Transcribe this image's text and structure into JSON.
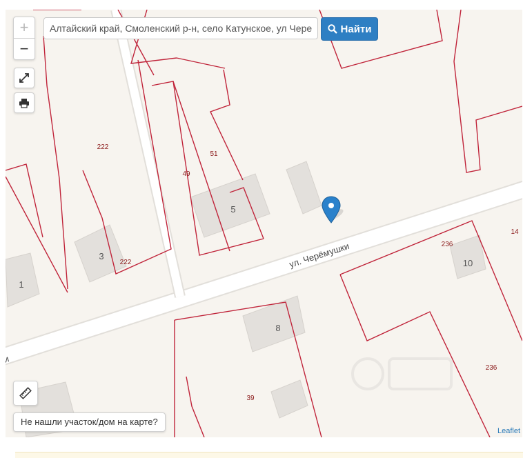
{
  "search": {
    "value": "Алтайский край, Смоленский р-н, село Катунское, ул Черемушки",
    "button_label": "Найти"
  },
  "zoom": {
    "in_label": "+",
    "out_label": "−"
  },
  "map": {
    "street_label": "ул. Черёмушки",
    "street_fragment": "и",
    "building_numbers": [
      "1",
      "3",
      "5",
      "8",
      "10"
    ],
    "parcel_numbers": [
      "222",
      "222",
      "51",
      "49",
      "236",
      "14",
      "236",
      "39"
    ]
  },
  "not_found_label": "Не нашли участок/дом на карте?",
  "attribution": "Leaflet",
  "colors": {
    "parcel_line": "#c0243a",
    "parcel_label": "#8b1a1a",
    "building": "#e3e0dc",
    "road": "#ffffff",
    "marker": "#2a81cb",
    "button": "#2e7fc3"
  },
  "icons": {
    "zoom_in": "plus-icon",
    "zoom_out": "minus-icon",
    "fullscreen": "expand-icon",
    "print": "print-icon",
    "ruler": "ruler-icon",
    "search": "search-icon",
    "marker": "map-marker-icon"
  }
}
